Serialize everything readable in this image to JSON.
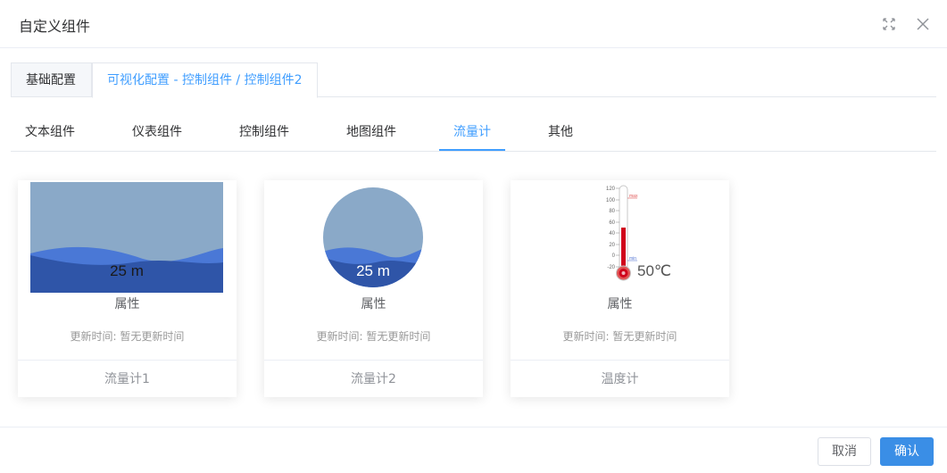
{
  "dialog": {
    "title": "自定义组件",
    "fullscreen_icon": "expand-icon",
    "close_icon": "close-icon"
  },
  "top_tabs": [
    {
      "label": "基础配置",
      "active": false
    },
    {
      "label": "可视化配置 - 控制组件 / 控制组件2",
      "active": true
    }
  ],
  "sub_tabs": [
    {
      "label": "文本组件",
      "active": false
    },
    {
      "label": "仪表组件",
      "active": false
    },
    {
      "label": "控制组件",
      "active": false
    },
    {
      "label": "地图组件",
      "active": false
    },
    {
      "label": "流量计",
      "active": true
    },
    {
      "label": "其他",
      "active": false
    }
  ],
  "cards": [
    {
      "name": "流量计1",
      "preview_value": "25 m",
      "attr_label": "属性",
      "update_label": "更新时间:",
      "update_value": "暂无更新时间"
    },
    {
      "name": "流量计2",
      "preview_value": "25 m",
      "attr_label": "属性",
      "update_label": "更新时间:",
      "update_value": "暂无更新时间"
    },
    {
      "name": "温度计",
      "preview_value": "50℃",
      "attr_label": "属性",
      "update_label": "更新时间:",
      "update_value": "暂无更新时间",
      "scale_ticks": [
        "120",
        "100",
        "80",
        "60",
        "40",
        "20",
        "0",
        "-20"
      ],
      "max_label": "max",
      "min_label": "min"
    }
  ],
  "footer": {
    "cancel_label": "取消",
    "confirm_label": "确认"
  },
  "colors": {
    "accent": "#409eff",
    "water_light": "#8aa9c8",
    "water_mid": "#4a78d6",
    "water_dark": "#2f55a8",
    "thermo_red": "#d0021b"
  }
}
